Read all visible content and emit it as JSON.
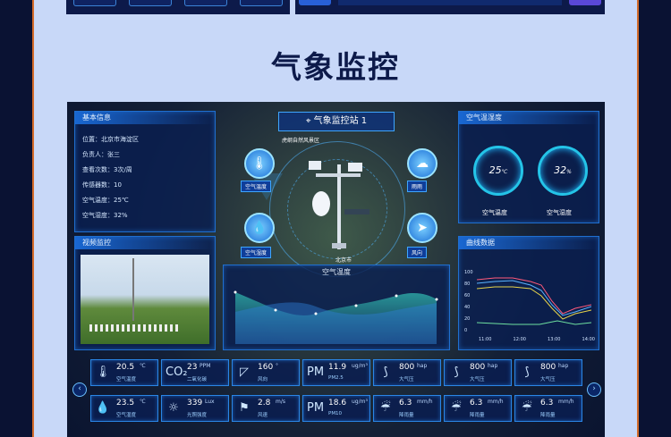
{
  "heading": "气象监控",
  "station": {
    "name": "气象监控站 1"
  },
  "info_panel": {
    "title": "基本信息",
    "rows": [
      "位置：北京市海淀区",
      "负责人：张三",
      "查看次数：3次/周",
      "传感器数：10",
      "空气温度：25℃",
      "空气湿度：32%"
    ]
  },
  "video_panel": {
    "title": "视频监控"
  },
  "humidity_panel": {
    "title": "空气温湿度",
    "gauges": [
      {
        "value": "25",
        "unit": "℃",
        "label": "空气温度"
      },
      {
        "value": "32",
        "unit": "%",
        "label": "空气湿度"
      }
    ]
  },
  "curve_panel": {
    "title": "曲线数据",
    "yticks": [
      "100",
      "80",
      "60",
      "40",
      "20",
      "0"
    ],
    "xticks": [
      "11:00",
      "12:00",
      "13:00",
      "14:00"
    ]
  },
  "air_temp_panel": {
    "title": "空气温度"
  },
  "map": {
    "labels": [
      "虎纲自然风景区",
      "北京市"
    ],
    "bubbles": [
      {
        "label": "空气温度",
        "icon": "thermometer-icon"
      },
      {
        "label": "雨雨",
        "icon": "cloud-rain-icon"
      },
      {
        "label": "空气湿度",
        "icon": "droplet-icon"
      },
      {
        "label": "风向",
        "icon": "wind-direction-icon"
      }
    ]
  },
  "tiles_row1": [
    {
      "icon": "🌡",
      "value": "20.5",
      "unit": "℃",
      "name": "空气温度"
    },
    {
      "icon": "CO₂",
      "value": "23",
      "unit": "PPM",
      "name": "二氧化碳"
    },
    {
      "icon": "◸",
      "value": "160",
      "unit": "°",
      "name": "风向"
    },
    {
      "icon": "PM",
      "value": "11.9",
      "unit": "ug/m³",
      "name": "PM2.5"
    },
    {
      "icon": "⟆",
      "value": "800",
      "unit": "hap",
      "name": "大气压"
    },
    {
      "icon": "⟆",
      "value": "800",
      "unit": "hap",
      "name": "大气压"
    },
    {
      "icon": "⟆",
      "value": "800",
      "unit": "hap",
      "name": "大气压"
    }
  ],
  "tiles_row2": [
    {
      "icon": "💧",
      "value": "23.5",
      "unit": "℃",
      "name": "空气湿度"
    },
    {
      "icon": "☼",
      "value": "339",
      "unit": "Lux",
      "name": "光照强度"
    },
    {
      "icon": "⚑",
      "value": "2.8",
      "unit": "m/s",
      "name": "风速"
    },
    {
      "icon": "PM",
      "value": "18.6",
      "unit": "ug/m³",
      "name": "PM10"
    },
    {
      "icon": "☔",
      "value": "6.3",
      "unit": "mm/h",
      "name": "降雨量"
    },
    {
      "icon": "☔",
      "value": "6.3",
      "unit": "mm/h",
      "name": "降雨量"
    },
    {
      "icon": "☔",
      "value": "6.3",
      "unit": "mm/h",
      "name": "降雨量"
    }
  ],
  "nav": {
    "prev": "‹",
    "next": "›"
  }
}
